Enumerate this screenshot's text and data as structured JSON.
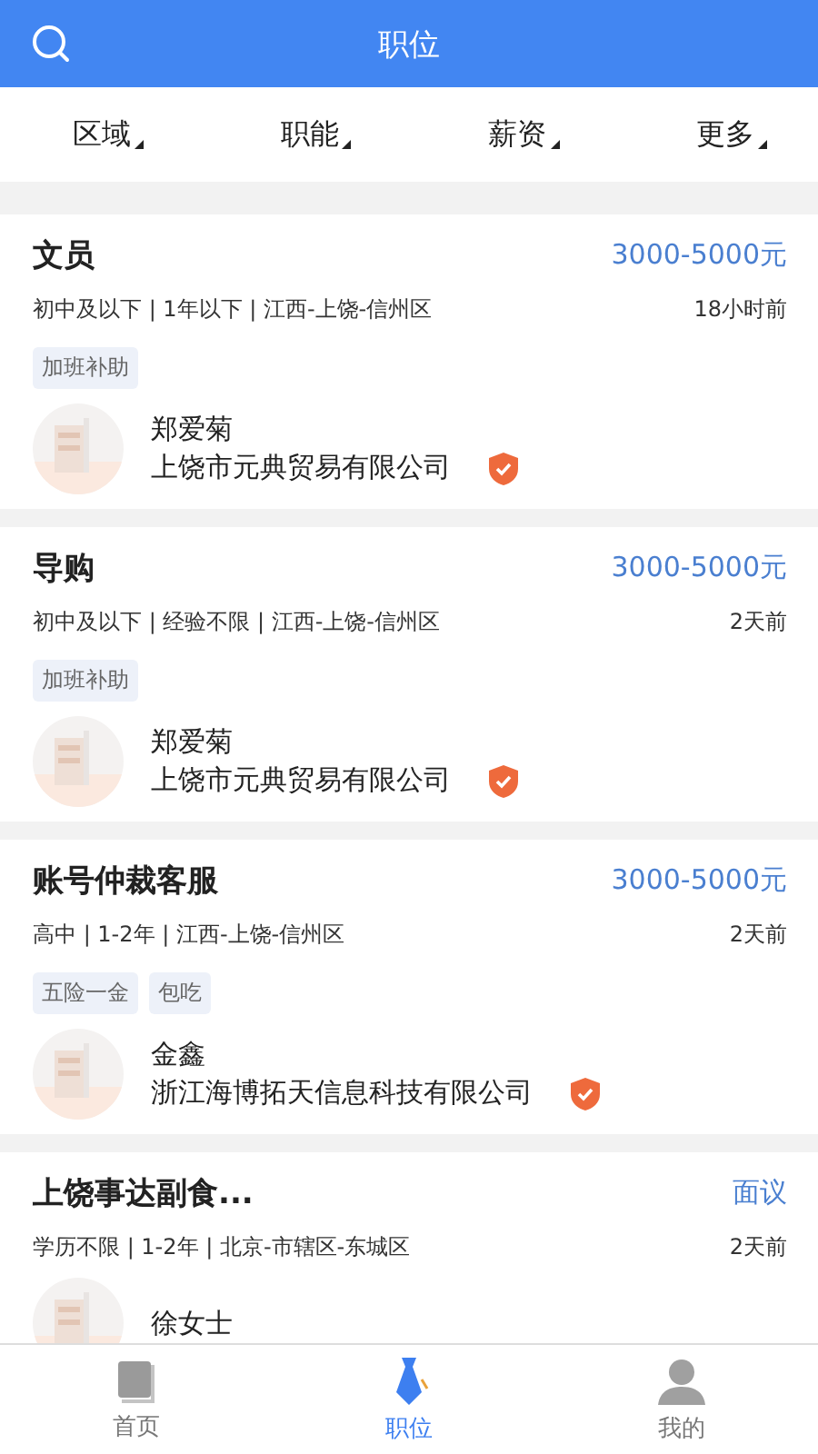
{
  "header": {
    "title": "职位"
  },
  "filters": [
    {
      "label": "区域"
    },
    {
      "label": "职能"
    },
    {
      "label": "薪资"
    },
    {
      "label": "更多"
    }
  ],
  "jobs": [
    {
      "title": "文员",
      "salary": "3000-5000元",
      "meta": "初中及以下 | 1年以下 | 江西-上饶-信州区",
      "time": "18小时前",
      "tags": [
        "加班补助"
      ],
      "recruiter": "郑爱菊",
      "company": "上饶市元典贸易有限公司",
      "verified": true
    },
    {
      "title": "导购",
      "salary": "3000-5000元",
      "meta": "初中及以下 | 经验不限 | 江西-上饶-信州区",
      "time": "2天前",
      "tags": [
        "加班补助"
      ],
      "recruiter": "郑爱菊",
      "company": "上饶市元典贸易有限公司",
      "verified": true
    },
    {
      "title": "账号仲裁客服",
      "salary": "3000-5000元",
      "meta": "高中 | 1-2年 | 江西-上饶-信州区",
      "time": "2天前",
      "tags": [
        "五险一金",
        "包吃"
      ],
      "recruiter": "金鑫",
      "company": "浙江海博拓天信息科技有限公司",
      "verified": true
    },
    {
      "title": "上饶事达副食...",
      "salary": "面议",
      "meta": "学历不限 | 1-2年 | 北京-市辖区-东城区",
      "time": "2天前",
      "recruiter": "徐女士"
    }
  ],
  "nav": [
    {
      "kind": "home",
      "label": "首页",
      "selected": false
    },
    {
      "kind": "jobs",
      "label": "职位",
      "selected": true
    },
    {
      "kind": "me",
      "label": "我的",
      "selected": false
    }
  ]
}
